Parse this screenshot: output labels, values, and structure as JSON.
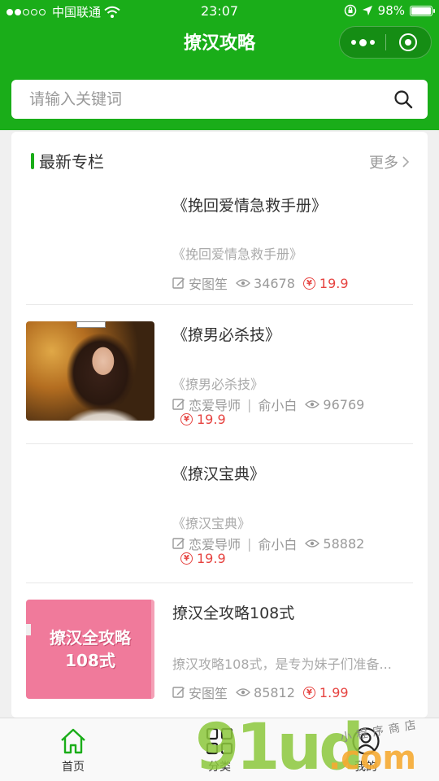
{
  "status_bar": {
    "carrier": "中国联通",
    "time": "23:07",
    "battery": "98%",
    "battery_level": 0.98
  },
  "nav": {
    "title": "撩汉攻略"
  },
  "search": {
    "placeholder": "请输入关键词",
    "value": ""
  },
  "section": {
    "title": "最新专栏",
    "more_label": "更多"
  },
  "items": [
    {
      "title": "《挽回爱情急救手册》",
      "desc": "《挽回爱情急救手册》",
      "author": "安图笙",
      "views": "34678",
      "price": "19.9",
      "thumb": "none"
    },
    {
      "title": "《撩男必杀技》",
      "desc": "《撩男必杀技》",
      "author": "恋爱导师",
      "author2": "俞小白",
      "views": "96769",
      "price": "19.9",
      "thumb": "photo"
    },
    {
      "title": "《撩汉宝典》",
      "desc": "《撩汉宝典》",
      "author": "恋爱导师",
      "author2": "俞小白",
      "views": "58882",
      "price": "19.9",
      "thumb": "none"
    },
    {
      "title": "撩汉全攻略108式",
      "desc": "撩汉攻略108式，是专为妹子们准备...",
      "author": "安图笙",
      "views": "85812",
      "price": "1.99",
      "thumb": "pink",
      "thumb_text_1": "撩汉全攻略",
      "thumb_text_2": "108式"
    }
  ],
  "tabbar": {
    "tabs": [
      {
        "label": "首页",
        "icon": "home-icon",
        "active": true
      },
      {
        "label": "分类",
        "icon": "grid-icon",
        "active": false
      },
      {
        "label": "我的",
        "icon": "user-icon",
        "active": false
      }
    ]
  },
  "watermark": {
    "brand": "91ud",
    "suffix": ".com",
    "shop": "小程序商店"
  },
  "colors": {
    "brand_green": "#1aad19",
    "price_red": "#e64340"
  },
  "price_symbol": "¥"
}
